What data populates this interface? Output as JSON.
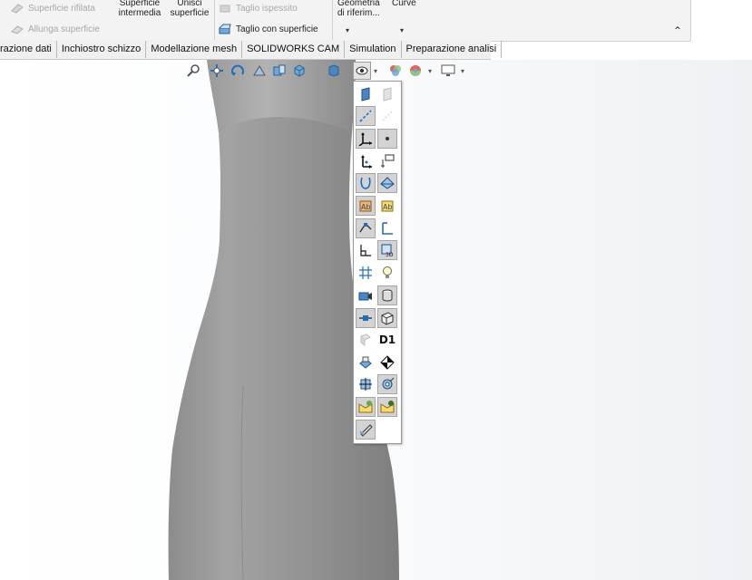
{
  "ribbon": {
    "surface_trimmed": "Superficie rifilata",
    "extend_surface": "Allunga superficie",
    "mid_surface_line1": "Superficie",
    "mid_surface_line2": "intermedia",
    "knit_line1": "Unisci",
    "knit_line2": "superficie",
    "thicken_cut": "Taglio ispessito",
    "surface_cut": "Taglio con superficie",
    "ref_geometry_line1": "Geometria",
    "ref_geometry_line2": "di riferim...",
    "curves": "Curve"
  },
  "tabs": [
    {
      "label": "razione dati"
    },
    {
      "label": "Inchiostro schizzo"
    },
    {
      "label": "Modellazione mesh"
    },
    {
      "label": "SOLIDWORKS CAM"
    },
    {
      "label": "Simulation"
    },
    {
      "label": "Preparazione analisi"
    }
  ],
  "flyout": {
    "dimension_label": "D1",
    "items": [
      "plane-icon",
      "plane-disabled-icon",
      "axis-icon",
      "axis-disabled-icon",
      "coordinate-system-icon",
      "point-icon",
      "origin-icon",
      "dimension-names-icon",
      "curves-icon",
      "parting-lines-icon",
      "sketch-text-icon",
      "annotation-text-icon",
      "sketch-relations-icon",
      "sketch-icon",
      "sketch-2d-icon",
      "sketch-3d-icon",
      "grid-icon",
      "lights-icon",
      "cameras-icon",
      "weldment-bead-icon",
      "routing-points-icon",
      "section-view-icon",
      "hide-icon",
      "dimension-names-text",
      "decals-icon",
      "center-of-mass-icon",
      "mate-references-icon",
      "connection-points-icon",
      "swift-annotations-icon",
      "swift-annotations-alt-icon",
      "all-annotations-icon"
    ]
  },
  "colors": {
    "model_gray": "#8f8f8f",
    "accent_blue": "#1e6fbf",
    "toolbar_bg": "#f3f3f3"
  }
}
